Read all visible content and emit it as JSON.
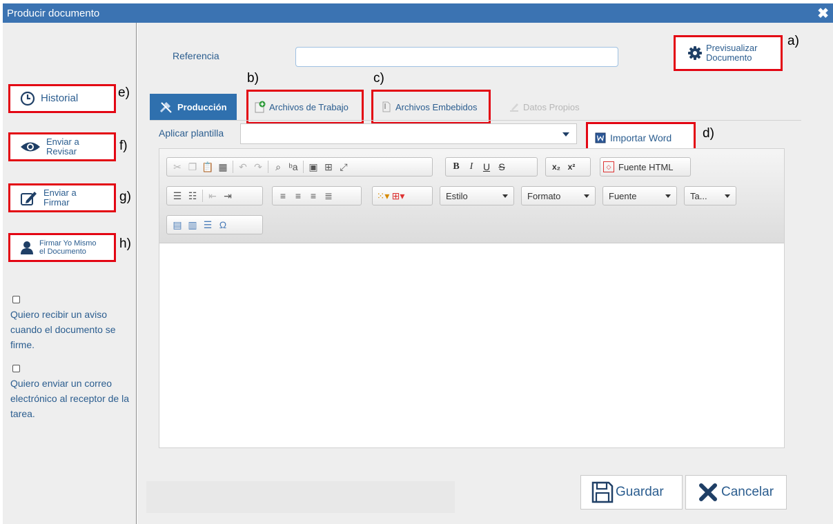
{
  "window": {
    "title": "Producir documento",
    "close_icon": "✖"
  },
  "sidebar": {
    "historial": "Historial",
    "enviar_revisar_1": "Enviar a",
    "enviar_revisar_2": "Revisar",
    "enviar_firmar_1": "Enviar a",
    "enviar_firmar_2": "Firmar",
    "firmar_yo_1": "Firmar Yo Mismo",
    "firmar_yo_2": "el Documento",
    "check1": "Quiero recibir un aviso cuando el documento se firme.",
    "check2": "Quiero enviar un correo electrónico al receptor de la tarea."
  },
  "annotations": {
    "a": "a)",
    "b": "b)",
    "c": "c)",
    "d": "d)",
    "e": "e)",
    "f": "f)",
    "g": "g)",
    "h": "h)"
  },
  "header": {
    "referencia_label": "Referencia",
    "referencia_value": "",
    "preview_1": "Previsualizar",
    "preview_2": "Documento"
  },
  "tabs": {
    "produccion": "Producción",
    "archivos_trabajo": "Archivos de Trabajo",
    "archivos_embebidos": "Archivos Embebidos",
    "datos_propios": "Datos Propios"
  },
  "plantilla": {
    "label": "Aplicar plantilla",
    "value": ""
  },
  "importar_word": "Importar Word",
  "toolbar": {
    "fuente_html": "Fuente HTML",
    "estilo": "Estilo",
    "formato": "Formato",
    "fuente": "Fuente",
    "tamano": "Ta...",
    "bold": "B",
    "italic": "I",
    "underline": "U",
    "strike": "S",
    "subscript": "x₂",
    "superscript": "x²",
    "omega": "Ω"
  },
  "footer": {
    "guardar": "Guardar",
    "cancelar": "Cancelar"
  },
  "colors": {
    "accent": "#3b73b2",
    "highlight": "#e30613",
    "link": "#2b5d8f"
  }
}
